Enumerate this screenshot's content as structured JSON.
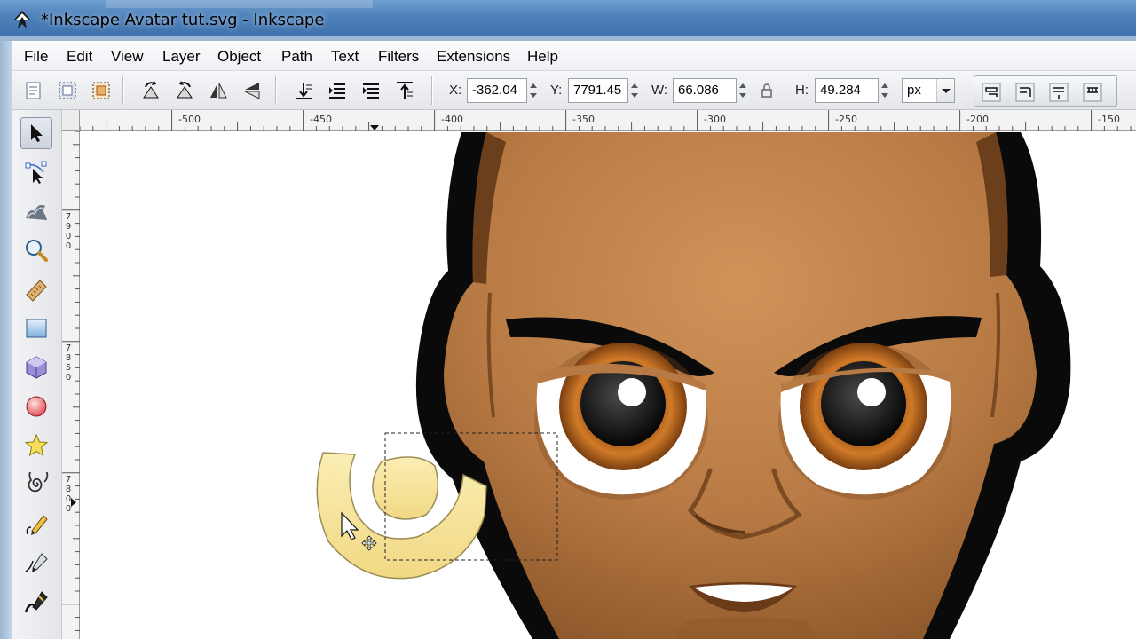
{
  "window": {
    "title": "*Inkscape Avatar tut.svg - Inkscape"
  },
  "menu": {
    "items": [
      "File",
      "Edit",
      "View",
      "Layer",
      "Object",
      "Path",
      "Text",
      "Filters",
      "Extensions",
      "Help"
    ]
  },
  "controls": {
    "x_label": "X:",
    "x_value": "-362.04",
    "y_label": "Y:",
    "y_value": "7791.45",
    "w_label": "W:",
    "w_value": "66.086",
    "h_label": "H:",
    "h_value": "49.284",
    "unit": "px"
  },
  "ruler": {
    "h_ticks": [
      "-500",
      "-450",
      "-400",
      "-350",
      "-300",
      "-250",
      "-200",
      "-150"
    ],
    "v_ticks": [
      [
        "7",
        "9",
        "0",
        "0"
      ],
      [
        "7",
        "8",
        "5",
        "0"
      ],
      [
        "7",
        "8",
        "0",
        "0"
      ]
    ]
  },
  "tools": [
    "selector-tool",
    "node-tool",
    "tweak-tool",
    "zoom-tool",
    "measure-tool",
    "rectangle-tool",
    "3d-box-tool",
    "ellipse-tool",
    "star-tool",
    "spiral-tool",
    "pencil-tool",
    "pen-tool",
    "calligraphy-tool"
  ],
  "colors": {
    "skin": "#b87a44",
    "outline": "#0a0a0a",
    "ear_shape": "#f6e39a",
    "iris": "#b5661f",
    "titlebar": "#4f82bb"
  }
}
